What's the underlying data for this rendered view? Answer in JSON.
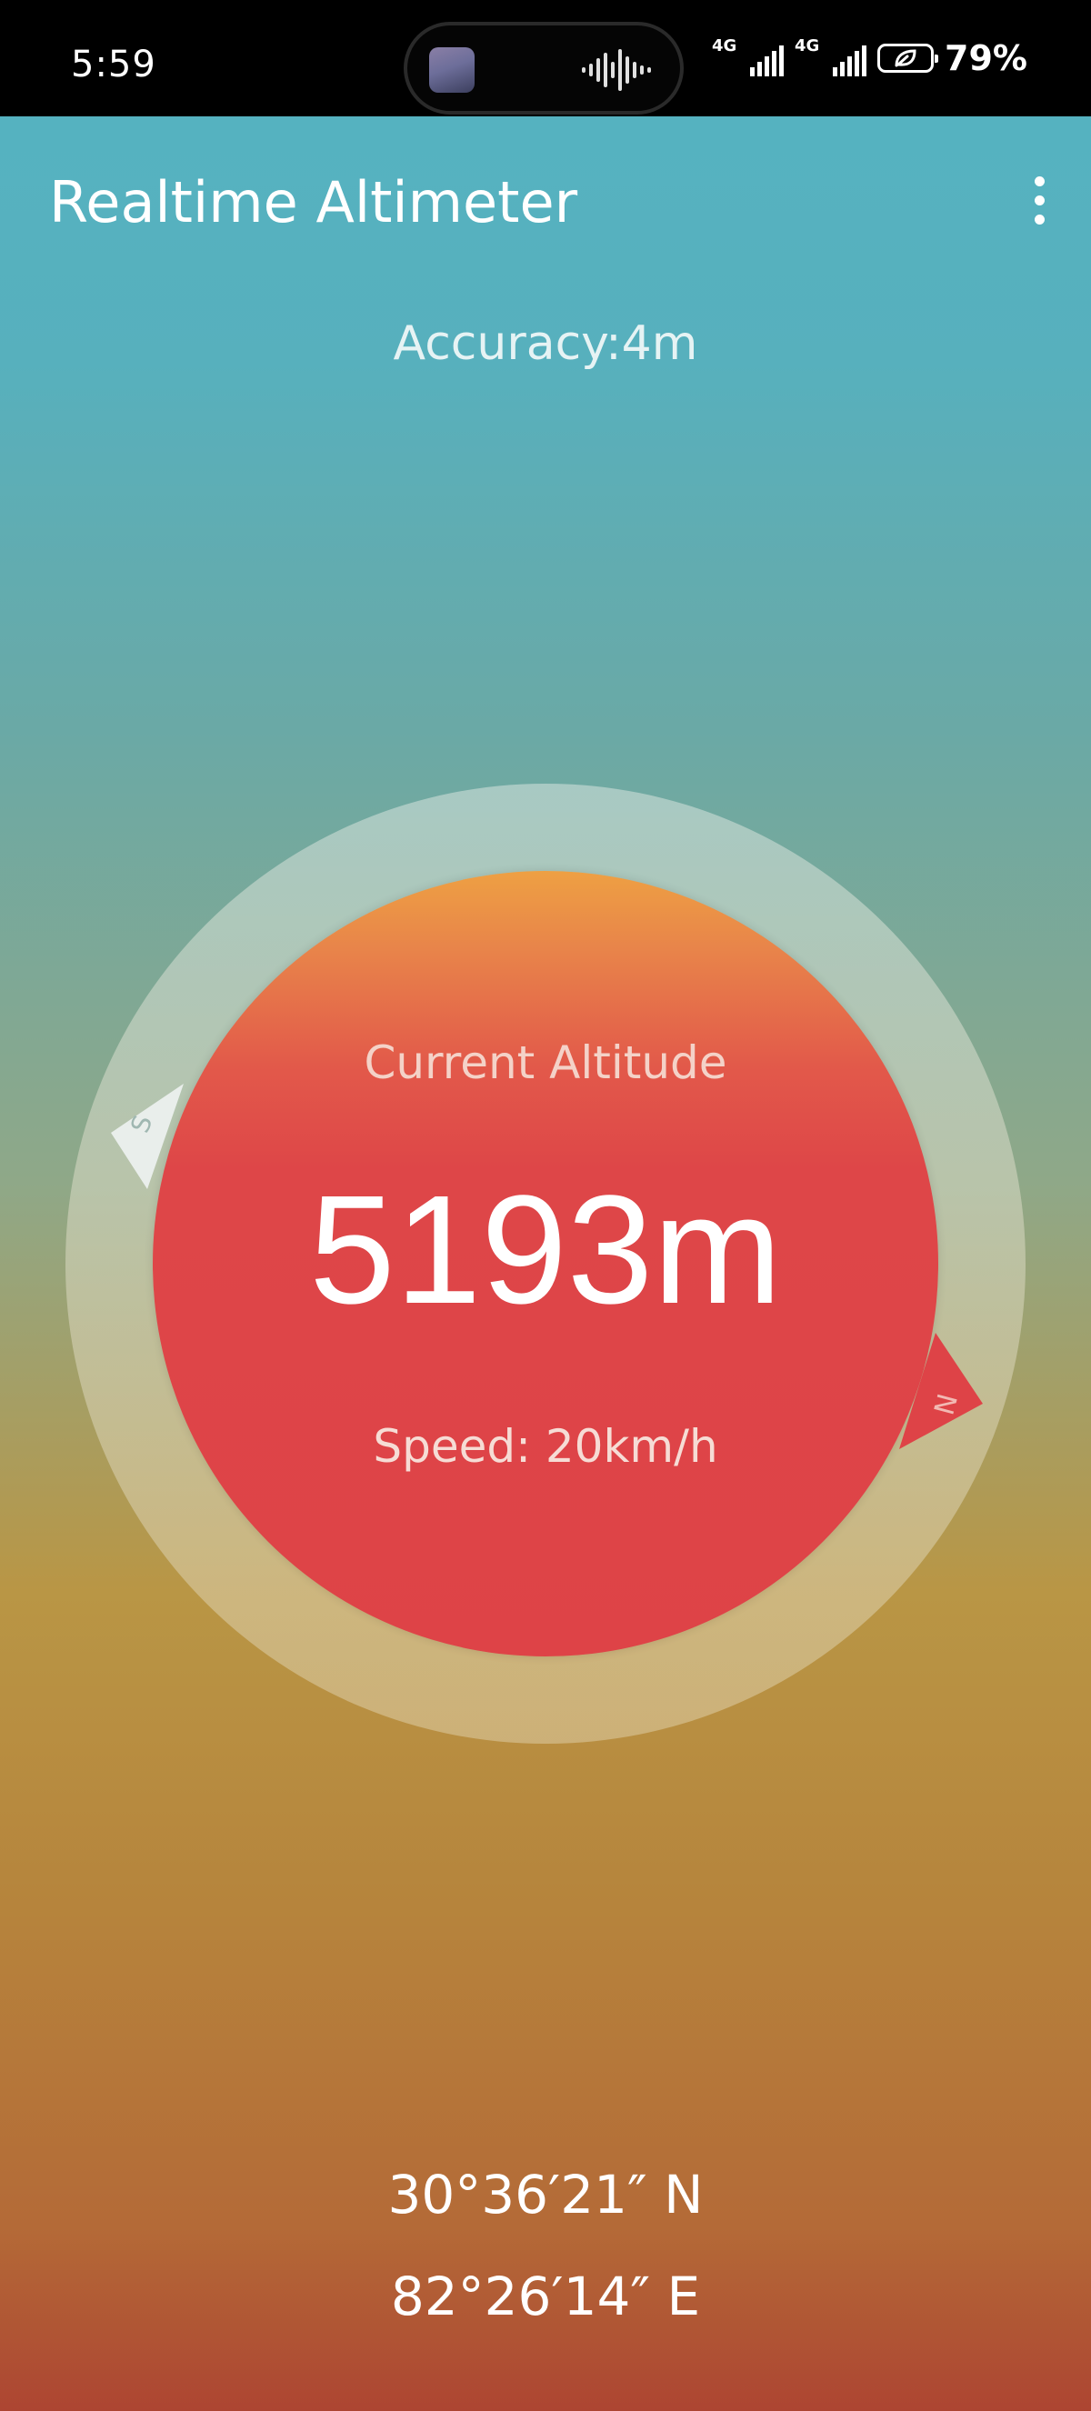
{
  "status_bar": {
    "time": "5:59",
    "network_1": "4G",
    "network_2": "4G",
    "battery": "79%"
  },
  "app_bar": {
    "title": "Realtime Altimeter"
  },
  "accuracy": "Accuracy:4m",
  "gauge": {
    "label": "Current Altitude",
    "altitude": "5193m",
    "speed": "Speed: 20km/h",
    "south_marker": "S",
    "north_marker": "N",
    "colors": {
      "south_marker": "#e9eeeb",
      "north_marker": "#de4347"
    }
  },
  "coordinates": {
    "latitude": "30°36′21″ N",
    "longitude": "82°26′14″ E"
  }
}
